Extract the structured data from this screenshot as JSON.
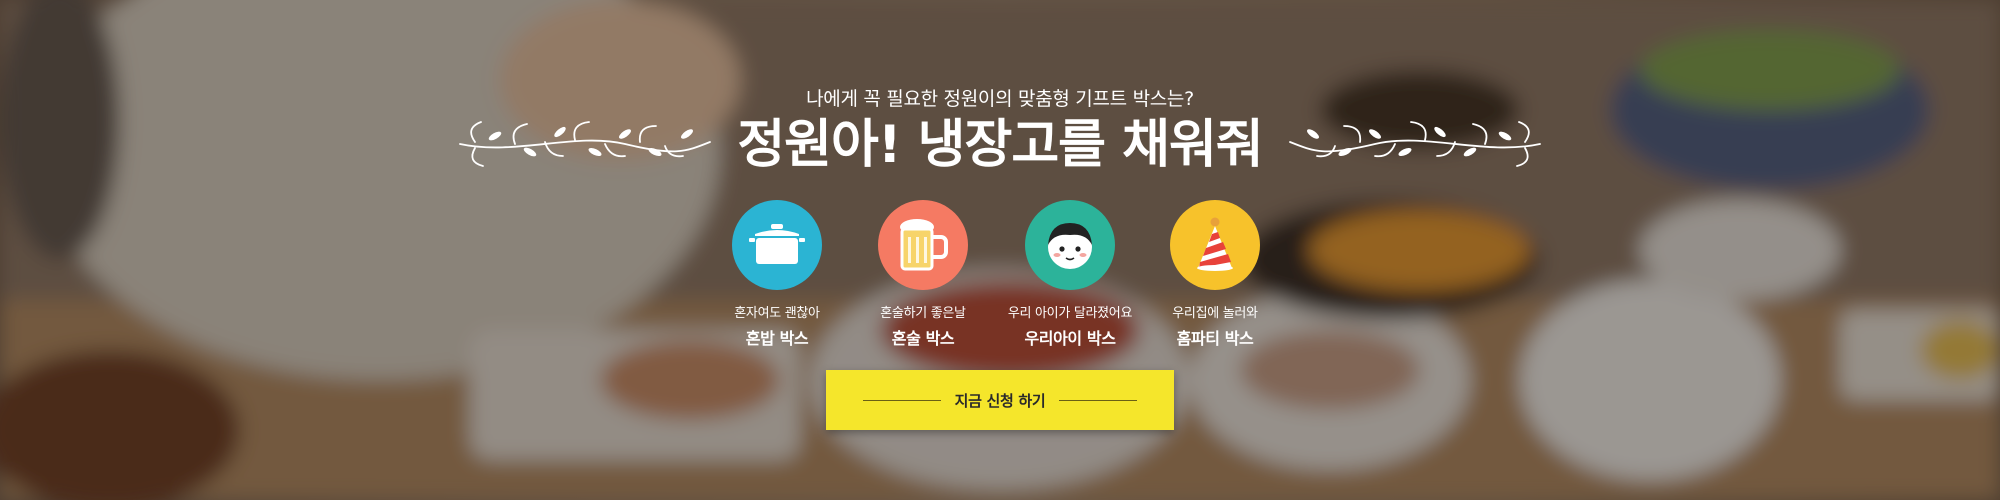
{
  "banner": {
    "subtitle": "나에게 꼭 필요한 정원이의 맞춤형 기프트 박스는?",
    "title": "정원아! 냉장고를 채워줘"
  },
  "boxes": [
    {
      "tagline": "혼자여도 괜찮아",
      "name": "혼밥 박스",
      "icon": "pot-icon",
      "color": "#2bb4d3"
    },
    {
      "tagline": "혼술하기 좋은날",
      "name": "혼술 박스",
      "icon": "beer-mug-icon",
      "color": "#f57a63"
    },
    {
      "tagline": "우리 아이가 달라졌어요",
      "name": "우리아이 박스",
      "icon": "child-face-icon",
      "color": "#2cb39a"
    },
    {
      "tagline": "우리집에 놀러와",
      "name": "홈파티 박스",
      "icon": "party-hat-icon",
      "color": "#f7c22b"
    }
  ],
  "cta": {
    "label": "지금 신청 하기",
    "color": "#f5e62b"
  }
}
